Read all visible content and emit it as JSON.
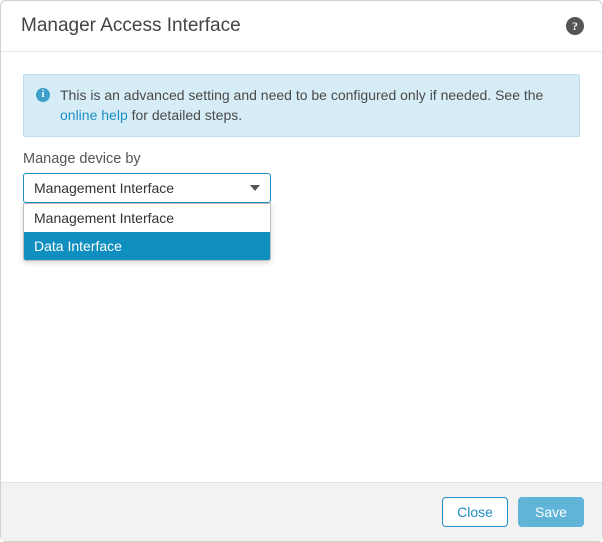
{
  "header": {
    "title": "Manager Access Interface",
    "help_tooltip": "?"
  },
  "info": {
    "text_before_link": "This is an advanced setting and need to be configured only if needed. See the ",
    "link_text": "online help",
    "text_after_link": " for detailed steps."
  },
  "field": {
    "label": "Manage device by",
    "selected": "Management Interface",
    "options": [
      "Management Interface",
      "Data Interface"
    ],
    "highlighted_index": 1
  },
  "footer": {
    "close": "Close",
    "save": "Save"
  }
}
